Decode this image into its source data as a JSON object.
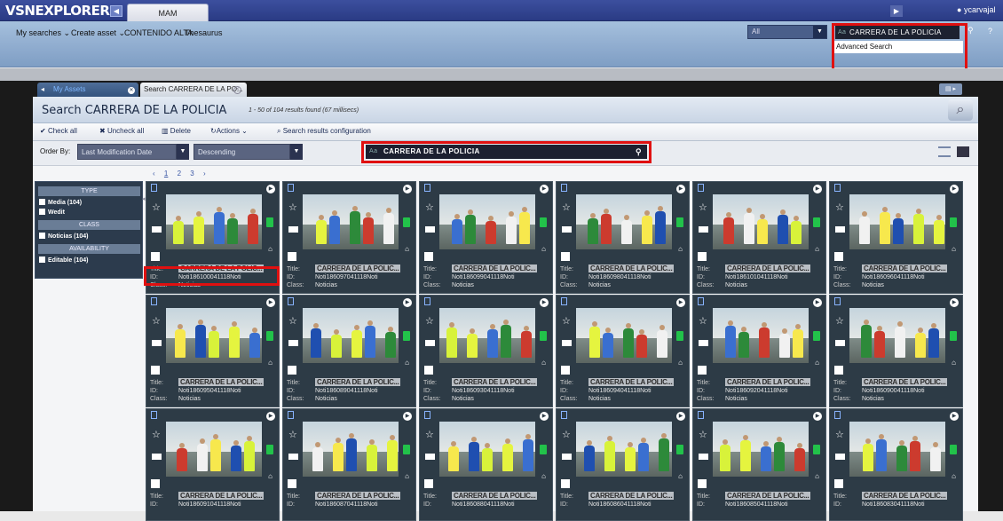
{
  "topbar": {
    "logo": "VSNEXPLORER",
    "tab_label": "MAM",
    "user": "ycarvajal"
  },
  "menu": {
    "items": [
      "My searches",
      "Create asset",
      "CONTENIDO ALTA",
      "Thesaurus"
    ],
    "filter_value": "All",
    "search_value": "CARRERA DE LA POLICIA",
    "search_prefix": "Aa",
    "advanced_search": "Advanced Search"
  },
  "tabs": [
    {
      "label": "My Assets"
    },
    {
      "label": "Search CARRERA DE LA PO..."
    }
  ],
  "panel": {
    "title": "Search CARRERA DE LA POLICIA",
    "result_count": "1 - 50 of 104 results found (67 millisecs)"
  },
  "toolbar": {
    "check_all": "Check all",
    "uncheck_all": "Uncheck all",
    "delete": "Delete",
    "actions": "Actions",
    "search_config": "Search results configuration"
  },
  "order": {
    "label": "Order By:",
    "field": "Last Modification Date",
    "direction": "Descending",
    "search_value": "CARRERA DE LA POLICIA",
    "search_prefix": "Aa"
  },
  "pager": [
    "1",
    "2",
    "3"
  ],
  "filters": {
    "type_header": "TYPE",
    "media": "Media (104)",
    "wedit": "Wedit",
    "class_header": "CLASS",
    "noticias": "Noticias (104)",
    "availability_header": "AVAILABILITY",
    "editable": "Editable (104)"
  },
  "meta_labels": {
    "title": "Title:",
    "id": "ID:",
    "class": "Class:"
  },
  "cards": [
    {
      "title": "CARRERA DE LA POLIC...",
      "id": "Noti186100041118Noti",
      "class": "Noticias"
    },
    {
      "title": "CARRERA DE LA POLIC...",
      "id": "Noti186097041118Noti",
      "class": "Noticias"
    },
    {
      "title": "CARRERA DE LA POLIC...",
      "id": "Noti186099041118Noti",
      "class": "Noticias"
    },
    {
      "title": "CARRERA DE LA POLIC...",
      "id": "Noti186098041118Noti",
      "class": "Noticias"
    },
    {
      "title": "CARRERA DE LA POLIC...",
      "id": "Noti186101041118Noti",
      "class": "Noticias"
    },
    {
      "title": "CARRERA DE LA POLIC...",
      "id": "Noti186096041118Noti",
      "class": "Noticias"
    },
    {
      "title": "CARRERA DE LA POLIC...",
      "id": "Noti186095041118Noti",
      "class": "Noticias"
    },
    {
      "title": "CARRERA DE LA POLIC...",
      "id": "Noti186089041118Noti",
      "class": "Noticias"
    },
    {
      "title": "CARRERA DE LA POLIC...",
      "id": "Noti186093041118Noti",
      "class": "Noticias"
    },
    {
      "title": "CARRERA DE LA POLIC...",
      "id": "Noti186094041118Noti",
      "class": "Noticias"
    },
    {
      "title": "CARRERA DE LA POLIC...",
      "id": "Noti186092041118Noti",
      "class": "Noticias"
    },
    {
      "title": "CARRERA DE LA POLIC...",
      "id": "Noti186090041118Noti",
      "class": "Noticias"
    },
    {
      "title": "CARRERA DE LA POLIC...",
      "id": "Noti186091041118Noti",
      "class": ""
    },
    {
      "title": "CARRERA DE LA POLIC...",
      "id": "Noti186087041118Noti",
      "class": ""
    },
    {
      "title": "CARRERA DE LA POLIC...",
      "id": "Noti186088041118Noti",
      "class": ""
    },
    {
      "title": "CARRERA DE LA POLIC...",
      "id": "Noti186086041118Noti",
      "class": ""
    },
    {
      "title": "CARRERA DE LA POLIC...",
      "id": "Noti186085041118Noti",
      "class": ""
    },
    {
      "title": "CARRERA DE LA POLIC...",
      "id": "Noti186083041118Noti",
      "class": ""
    }
  ]
}
